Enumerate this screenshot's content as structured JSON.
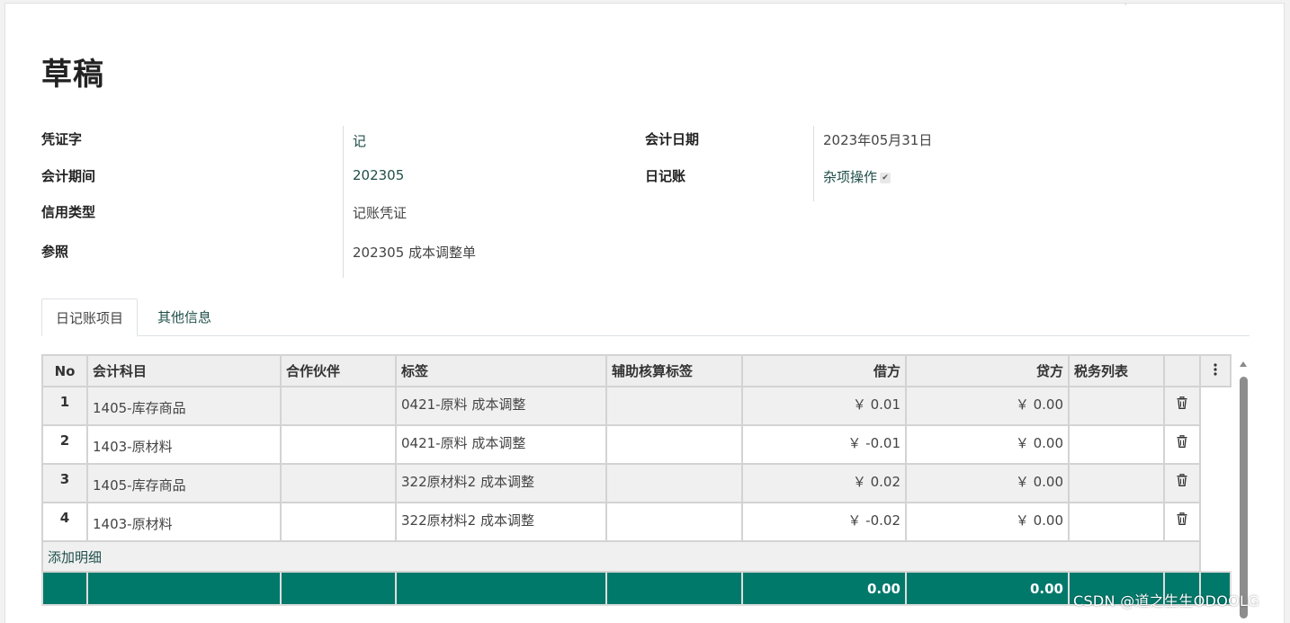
{
  "record": {
    "status_title": "草稿"
  },
  "fields": {
    "voucher_type_label": "凭证字",
    "voucher_type_value": "记",
    "period_label": "会计期间",
    "period_value": "202305",
    "credit_type_label": "信用类型",
    "credit_type_value": "记账凭证",
    "reference_label": "参照",
    "reference_value": "202305 成本调整单",
    "date_label": "会计日期",
    "date_value": "2023年05月31日",
    "journal_label": "日记账",
    "journal_value": "杂项操作"
  },
  "tabs": [
    {
      "label": "日记账项目",
      "active": true
    },
    {
      "label": "其他信息",
      "active": false
    }
  ],
  "table": {
    "headers": {
      "no": "No",
      "account": "会计科目",
      "partner": "合作伙伴",
      "label": "标签",
      "analytic": "辅助核算标签",
      "debit": "借方",
      "credit": "贷方",
      "taxes": "税务列表"
    },
    "rows": [
      {
        "no": "1",
        "account": "1405-库存商品",
        "partner": "",
        "label": "0421-原料 成本调整",
        "analytic": "",
        "debit": "￥ 0.01",
        "credit": "￥ 0.00",
        "taxes": ""
      },
      {
        "no": "2",
        "account": "1403-原材料",
        "partner": "",
        "label": "0421-原料 成本调整",
        "analytic": "",
        "debit": "￥ -0.01",
        "credit": "￥ 0.00",
        "taxes": ""
      },
      {
        "no": "3",
        "account": "1405-库存商品",
        "partner": "",
        "label": "322原材料2 成本调整",
        "analytic": "",
        "debit": "￥ 0.02",
        "credit": "￥ 0.00",
        "taxes": ""
      },
      {
        "no": "4",
        "account": "1403-原材料",
        "partner": "",
        "label": "322原材料2 成本调整",
        "analytic": "",
        "debit": "￥ -0.02",
        "credit": "￥ 0.00",
        "taxes": ""
      }
    ],
    "add_line_label": "添加明细",
    "totals": {
      "debit": "0.00",
      "credit": "0.00"
    }
  },
  "icons": {
    "delete": "trash-icon",
    "column_menu": "kebab-menu-icon",
    "journal_dropdown": "check-dropdown-icon"
  },
  "colors": {
    "total_row": "#00796b",
    "link": "#1f4f4a"
  },
  "watermark": "CSDN @道之生生ODOOLG"
}
